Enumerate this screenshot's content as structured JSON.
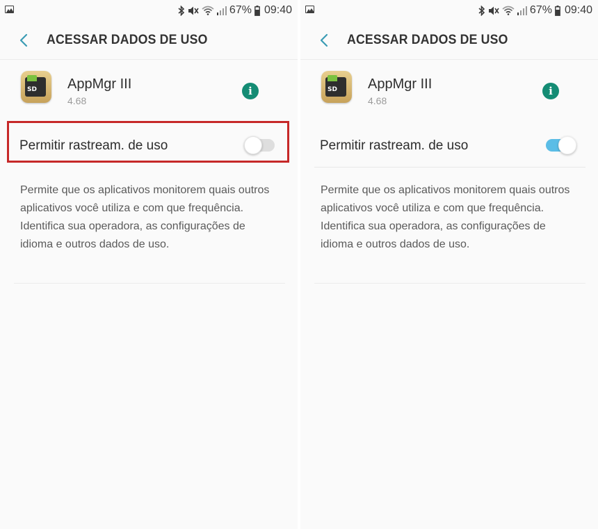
{
  "status_bar": {
    "battery_percent": "67%",
    "time": "09:40"
  },
  "header": {
    "title": "ACESSAR DADOS DE USO"
  },
  "app": {
    "name": "AppMgr III",
    "version": "4.68",
    "icon_text": "SD"
  },
  "setting": {
    "label": "Permitir rastream. de uso",
    "description": "Permite que os aplicativos monitorem quais outros aplicativos você utiliza e com que frequência. Identifica sua operadora, as configurações de idioma e outros dados de uso."
  },
  "screens": [
    {
      "toggle_state": "off",
      "highlighted": true
    },
    {
      "toggle_state": "on",
      "highlighted": false
    }
  ],
  "colors": {
    "info_icon": "#148c74",
    "toggle_on": "#5bbde6",
    "toggle_off": "#dedede",
    "highlight": "#c62828",
    "back_arrow": "#3a9bb4"
  }
}
